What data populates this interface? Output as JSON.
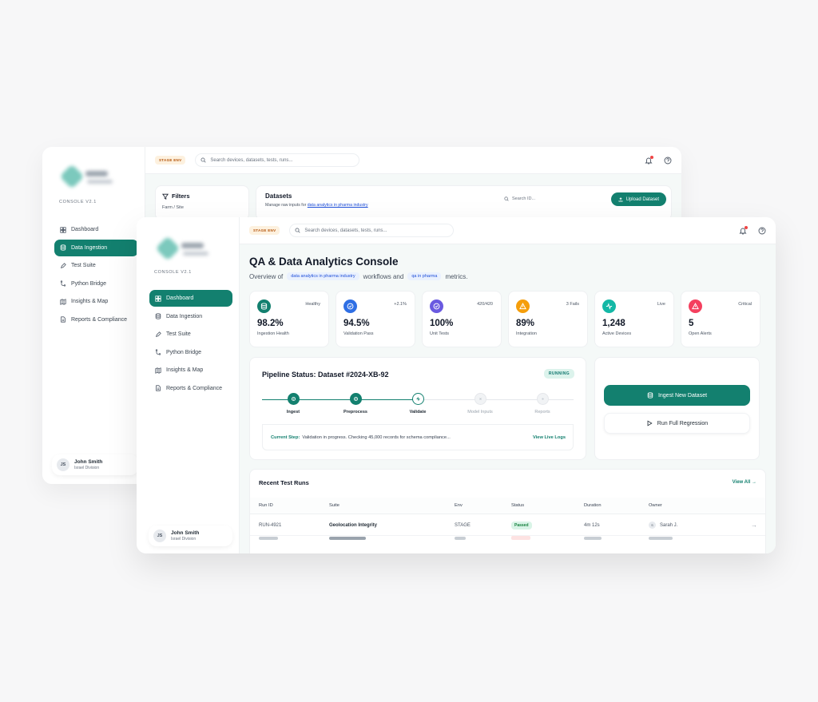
{
  "app": {
    "version": "CONSOLE V2.1",
    "stage_badge": "STAGE ENV",
    "search_placeholder": "Search devices, datasets, tests, runs..."
  },
  "sidebar": {
    "items": [
      {
        "label": "Dashboard",
        "icon": "dashboard-icon"
      },
      {
        "label": "Data Ingestion",
        "icon": "database-icon"
      },
      {
        "label": "Test Suite",
        "icon": "pencil-icon"
      },
      {
        "label": "Python Bridge",
        "icon": "branch-icon"
      },
      {
        "label": "Insights & Map",
        "icon": "map-icon"
      },
      {
        "label": "Reports & Compliance",
        "icon": "report-icon"
      }
    ],
    "back_active": "Data Ingestion",
    "front_active": "Dashboard"
  },
  "user": {
    "initials": "JS",
    "name": "John Smith",
    "division": "Israel Division"
  },
  "back_page": {
    "filters_title": "Filters",
    "filters_sub": "Farm / Site",
    "datasets_title": "Datasets",
    "datasets_desc": "Manage raw inputs for",
    "datasets_link": "data analytics in pharma industry",
    "search_id": "Search ID...",
    "upload_label": "Upload Dataset"
  },
  "dashboard": {
    "title": "QA & Data Analytics Console",
    "overview_prefix": "Overview of",
    "chip1": "data analytics in pharma industry",
    "overview_mid": "workflows and",
    "chip2": "qa in pharma",
    "overview_suffix": "metrics."
  },
  "stats": [
    {
      "tag": "Healthy",
      "value": "98.2%",
      "label": "Ingestion Health",
      "color": "#13806f",
      "icon": "database-icon"
    },
    {
      "tag": "+2.1%",
      "value": "94.5%",
      "label": "Validation Pass",
      "color": "#2f6fe4",
      "icon": "check-circle-icon"
    },
    {
      "tag": "420/420",
      "value": "100%",
      "label": "Unit Tests",
      "color": "#6a5ae0",
      "icon": "check-circle-icon"
    },
    {
      "tag": "3 Fails",
      "value": "89%",
      "label": "Integration",
      "color": "#f59e0b",
      "icon": "warning-icon"
    },
    {
      "tag": "Live",
      "value": "1,248",
      "label": "Active Devices",
      "color": "#14b8a6",
      "icon": "activity-icon"
    },
    {
      "tag": "Critical",
      "value": "5",
      "label": "Open Alerts",
      "color": "#f43f5e",
      "icon": "alert-icon"
    }
  ],
  "pipeline": {
    "title": "Pipeline Status: Dataset #2024-XB-92",
    "status": "RUNNING",
    "steps": [
      {
        "label": "Ingest",
        "state": "done"
      },
      {
        "label": "Preprocess",
        "state": "done"
      },
      {
        "label": "Validate",
        "state": "current"
      },
      {
        "label": "Model Inputs",
        "state": "pending"
      },
      {
        "label": "Reports",
        "state": "pending"
      }
    ],
    "progress": 0.5,
    "current_label": "Current Step:",
    "current_text": "Validation in progress. Checking 45,000 records for schema compliance...",
    "live_logs": "View Live Logs"
  },
  "actions": {
    "ingest": "Ingest New Dataset",
    "regression": "Run Full Regression"
  },
  "runs": {
    "title": "Recent Test Runs",
    "view_all": "View All →",
    "headers": [
      "Run ID",
      "Suite",
      "Env",
      "Status",
      "Duration",
      "Owner"
    ],
    "rows": [
      {
        "id": "RUN-4921",
        "suite": "Geolocation Integrity",
        "env": "STAGE",
        "status": "Passed",
        "duration": "4m 12s",
        "owner": "Sarah J.",
        "owner_initial": "S"
      }
    ]
  },
  "colors": {
    "accent": "#13806f",
    "stage": "#b45309"
  }
}
